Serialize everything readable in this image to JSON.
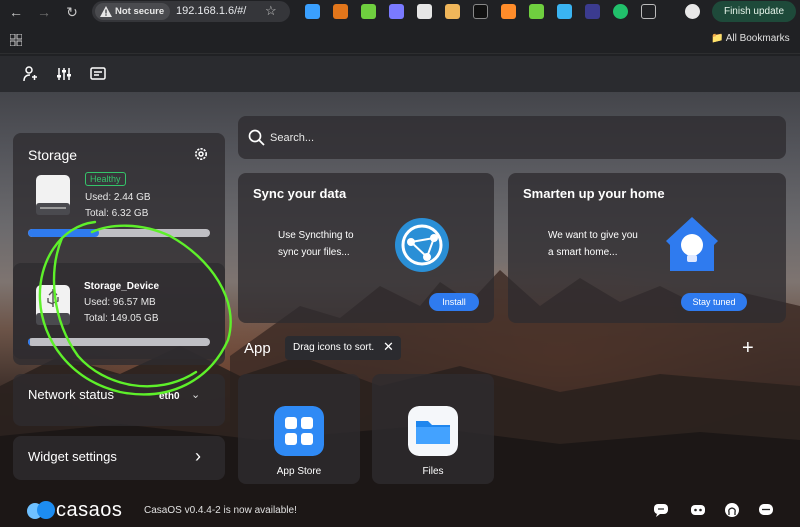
{
  "browser": {
    "security_label": "Not secure",
    "url": "192.168.1.6/#/",
    "finish_update_label": "Finish update",
    "all_bookmarks_label": "All Bookmarks"
  },
  "search": {
    "placeholder": "Search..."
  },
  "storage": {
    "title": "Storage",
    "disks": [
      {
        "badge": "Healthy",
        "used": "Used: 2.44 GB",
        "total": "Total: 6.32 GB",
        "usage_fraction": 0.39,
        "bar_color": "#2f7bef"
      },
      {
        "name": "Storage_Device",
        "used": "Used: 96.57 MB",
        "total": "Total: 149.05 GB",
        "usage_fraction": 0.01,
        "bar_color": "#2f7bef"
      }
    ]
  },
  "network": {
    "title": "Network status",
    "interface": "eth0"
  },
  "widget_settings": {
    "title": "Widget settings"
  },
  "sync_card": {
    "title": "Sync your data",
    "text_line1": "Use Syncthing to",
    "text_line2": "sync your files...",
    "button": "Install"
  },
  "home_card": {
    "title": "Smarten up your home",
    "text_line1": "We want to give you",
    "text_line2": "a smart home...",
    "button": "Stay tuned"
  },
  "apps_section": {
    "title": "App",
    "tooltip": "Drag icons to sort.",
    "apps": [
      {
        "name": "App Store",
        "icon": "app-store-icon"
      },
      {
        "name": "Files",
        "icon": "folder-icon"
      }
    ]
  },
  "footer": {
    "brand": "casaos",
    "version_notice": "CasaOS v0.4.4-2 is now available!"
  },
  "colors": {
    "accent": "#2f7bef",
    "healthy": "#35c46a",
    "annotation": "#5ef02a"
  }
}
